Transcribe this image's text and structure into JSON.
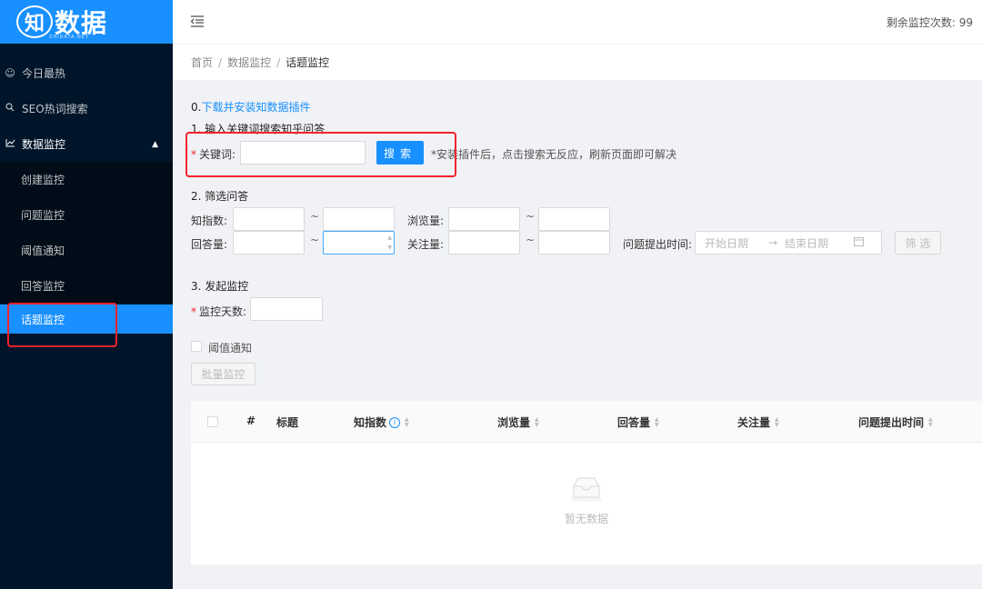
{
  "logo": {
    "mark": "知",
    "text": "数据",
    "subtitle": "ZHIDATA.NET"
  },
  "sidebar": {
    "items": [
      {
        "label": "今日最热",
        "icon": "smile-icon"
      },
      {
        "label": "SEO热词搜索",
        "icon": "search-icon"
      },
      {
        "label": "数据监控",
        "icon": "line-chart-icon",
        "expanded": true
      },
      {
        "label": "创建监控"
      },
      {
        "label": "问题监控"
      },
      {
        "label": "阈值通知"
      },
      {
        "label": "回答监控"
      },
      {
        "label": "话题监控",
        "active": true
      }
    ]
  },
  "header": {
    "quota_label": "剩余监控次数:",
    "quota_value": "99"
  },
  "breadcrumb": {
    "items": [
      "首页",
      "数据监控",
      "话题监控"
    ]
  },
  "step0": {
    "prefix": "0.",
    "link": "下载并安装知数据插件"
  },
  "step1": {
    "title": "1. 输入关键词搜索知乎问答",
    "keyword_label": "关键词:",
    "search_button": "搜索",
    "hint": "*安装插件后，点击搜索无反应，刷新页面即可解决"
  },
  "step2": {
    "title": "2. 筛选问答",
    "zhishu_label": "知指数:",
    "views_label": "浏览量:",
    "answers_label": "回答量:",
    "follows_label": "关注量:",
    "tilde": "~",
    "date_label": "问题提出时间:",
    "date_start_placeholder": "开始日期",
    "date_arrow": "→",
    "date_end_placeholder": "结束日期",
    "filter_button": "筛 选"
  },
  "step3": {
    "title": "3. 发起监控",
    "days_label": "监控天数:",
    "threshold_label": "阈值通知",
    "batch_button": "批量监控"
  },
  "table": {
    "columns": [
      "#",
      "标题",
      "知指数",
      "浏览量",
      "回答量",
      "关注量",
      "问题提出时间"
    ],
    "empty_text": "暂无数据"
  },
  "colors": {
    "primary": "#1890ff",
    "sidebar": "#001529",
    "highlight": "#f5222d"
  }
}
